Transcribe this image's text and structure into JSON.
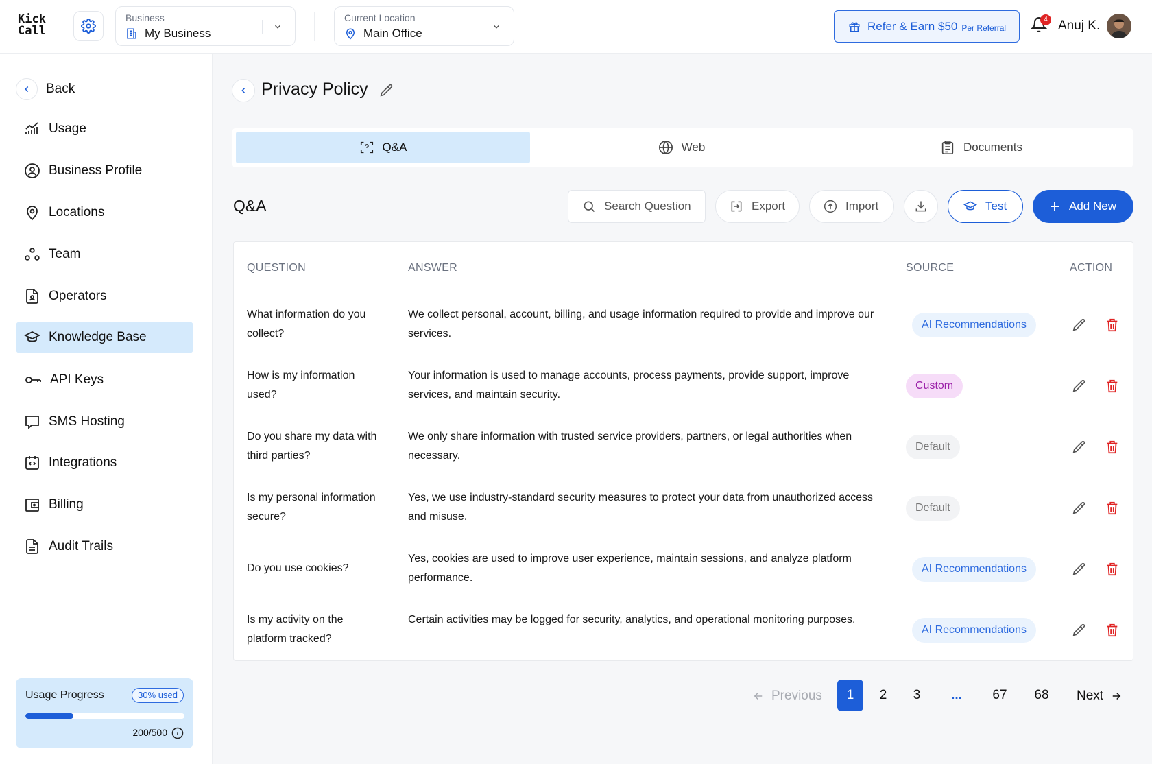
{
  "app": {
    "logo_line1": "Kick",
    "logo_line2": "Call"
  },
  "header": {
    "business": {
      "caption": "Business",
      "value": "My Business"
    },
    "location": {
      "caption": "Current Location",
      "value": "Main Office"
    },
    "refer": {
      "label": "Refer & Earn $50",
      "sub": "Per Referral"
    },
    "notifications_count": "4",
    "user_name": "Anuj K."
  },
  "sidebar": {
    "back_label": "Back",
    "items": [
      {
        "label": "Usage",
        "icon": "chart-icon",
        "active": false
      },
      {
        "label": "Business Profile",
        "icon": "user-circle-icon",
        "active": false
      },
      {
        "label": "Locations",
        "icon": "location-pin-icon",
        "active": false
      },
      {
        "label": "Team",
        "icon": "team-icon",
        "active": false
      },
      {
        "label": "Operators",
        "icon": "operator-file-icon",
        "active": false
      },
      {
        "label": "Knowledge Base",
        "icon": "graduation-cap-icon",
        "active": true
      },
      {
        "label": "API Keys",
        "icon": "key-icon",
        "active": false
      },
      {
        "label": "SMS Hosting",
        "icon": "message-icon",
        "active": false
      },
      {
        "label": "Integrations",
        "icon": "code-icon",
        "active": false
      },
      {
        "label": "Billing",
        "icon": "wallet-icon",
        "active": false
      },
      {
        "label": "Audit Trails",
        "icon": "document-icon",
        "active": false
      }
    ],
    "usage": {
      "title": "Usage Progress",
      "percent_label": "30% used",
      "progress_fraction": 0.3,
      "count": "200/500"
    }
  },
  "page": {
    "title": "Privacy Policy",
    "tabs": [
      {
        "label": "Q&A",
        "icon": "qa-scan-icon",
        "active": true
      },
      {
        "label": "Web",
        "icon": "globe-icon",
        "active": false
      },
      {
        "label": "Documents",
        "icon": "clipboard-icon",
        "active": false
      }
    ],
    "section_title": "Q&A",
    "toolbar": {
      "search": "Search Question",
      "export": "Export",
      "import": "Import",
      "test": "Test",
      "add": "Add New"
    },
    "table": {
      "headers": [
        "QUESTION",
        "ANSWER",
        "SOURCE",
        "ACTION"
      ],
      "rows": [
        {
          "question": "What information do you collect?",
          "answer": "We collect personal, account, billing, and usage information required to provide and improve our services.",
          "source": "AI Recommendations",
          "type": "ai"
        },
        {
          "question": "How is my information used?",
          "answer": "Your information is used to manage accounts, process payments, provide support, improve services, and maintain security.",
          "source": "Custom",
          "type": "custom"
        },
        {
          "question": "Do you share my data with third parties?",
          "answer": "We only share information with trusted service providers, partners, or legal authorities when necessary.",
          "source": "Default",
          "type": "default"
        },
        {
          "question": "Is my personal information secure?",
          "answer": "Yes, we use industry-standard security measures to protect your data from unauthorized access and misuse.",
          "source": "Default",
          "type": "default"
        },
        {
          "question": "Do you use cookies?",
          "answer": "Yes, cookies are used to improve user experience, maintain sessions, and analyze platform performance.",
          "source": "AI Recommendations",
          "type": "ai"
        },
        {
          "question": "Is my activity on the platform tracked?",
          "answer": "Certain activities may be logged for security, analytics, and operational monitoring purposes.",
          "source": "AI Recommendations",
          "type": "ai"
        }
      ]
    },
    "pagination": {
      "previous": "Previous",
      "pages": [
        "1",
        "2",
        "3",
        "...",
        "67",
        "68"
      ],
      "current": "1",
      "next": "Next"
    }
  },
  "colors": {
    "accent": "#1d5ed8",
    "active_bg": "#d5eafc",
    "danger": "#e02424",
    "custom_badge": "#9b1fa8"
  }
}
